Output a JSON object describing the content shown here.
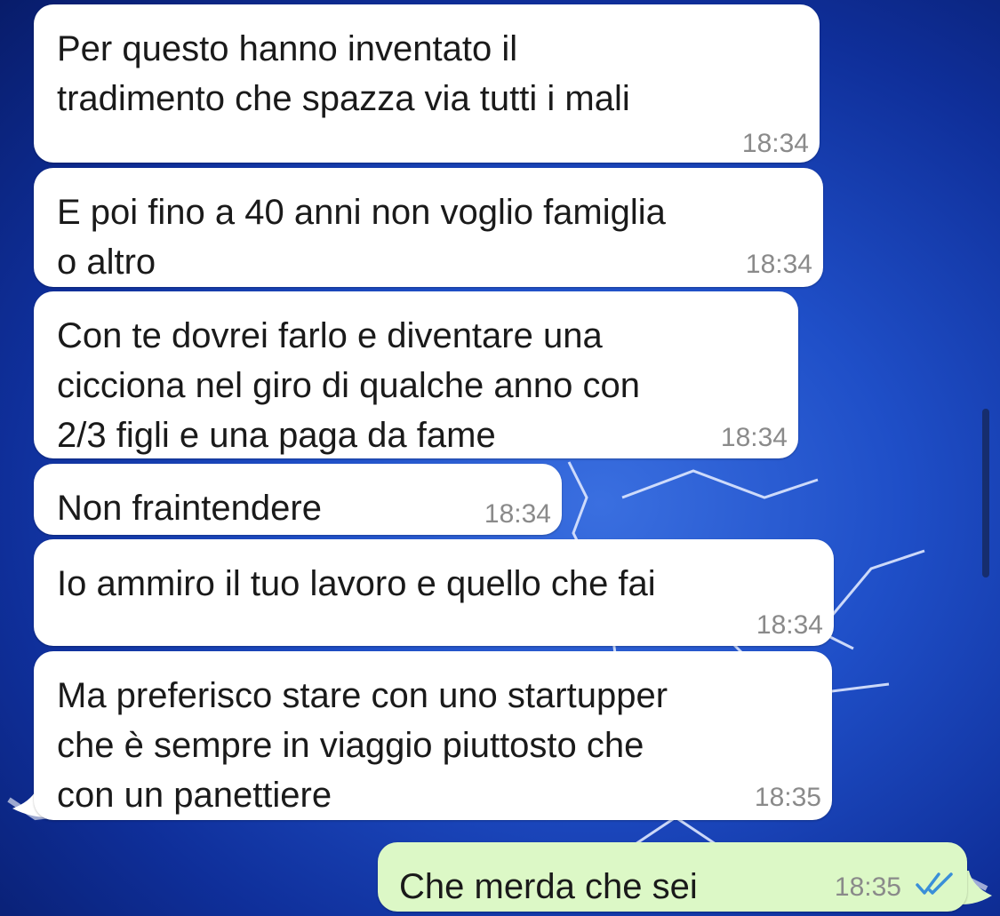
{
  "chat": {
    "messages": [
      {
        "direction": "incoming",
        "text": "Per questo hanno inventato il\ntradimento che spazza via tutti i mali",
        "time": "18:34"
      },
      {
        "direction": "incoming",
        "text": "E poi fino a 40 anni non voglio famiglia\no altro",
        "time": "18:34"
      },
      {
        "direction": "incoming",
        "text": "Con te dovrei farlo e diventare una\ncicciona nel giro di qualche anno con\n2/3 figli e una paga da fame",
        "time": "18:34"
      },
      {
        "direction": "incoming",
        "text": "Non fraintendere",
        "time": "18:34"
      },
      {
        "direction": "incoming",
        "text": "Io ammiro il tuo lavoro e quello che fai",
        "time": "18:34"
      },
      {
        "direction": "incoming",
        "text": "Ma preferisco stare con uno startupper\nche è sempre in viaggio piuttosto che\ncon un panettiere",
        "time": "18:35"
      },
      {
        "direction": "outgoing",
        "text": "Che merda che sei",
        "time": "18:35",
        "status_icon": "double-check-icon"
      }
    ]
  },
  "colors": {
    "incoming_bubble": "#ffffff",
    "outgoing_bubble": "#dcf8c6",
    "read_ticks": "#3a8fd8",
    "background": "#1f4fc8"
  }
}
